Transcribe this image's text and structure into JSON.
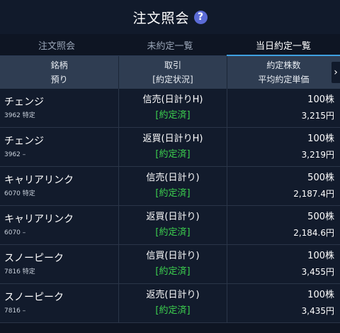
{
  "header": {
    "title": "注文照会",
    "help_icon": "?"
  },
  "tabs": [
    {
      "label": "注文照会",
      "active": false
    },
    {
      "label": "未約定一覧",
      "active": false
    },
    {
      "label": "当日約定一覧",
      "active": true
    }
  ],
  "columns": {
    "col1_top": "銘柄",
    "col1_bottom": "預り",
    "col2_top": "取引",
    "col2_bottom": "[約定状況]",
    "col3_top": "約定株数",
    "col3_bottom": "平均約定単価",
    "scroll_glyph": "›"
  },
  "rows": [
    {
      "name": "チェンジ",
      "code": "3962 特定",
      "type": "信売(日計りH)",
      "status": "[約定済]",
      "qty": "100株",
      "price": "3,215円"
    },
    {
      "name": "チェンジ",
      "code": "3962 –",
      "type": "返買(日計りH)",
      "status": "[約定済]",
      "qty": "100株",
      "price": "3,219円"
    },
    {
      "name": "キャリアリンク",
      "code": "6070 特定",
      "type": "信売(日計り)",
      "status": "[約定済]",
      "qty": "500株",
      "price": "2,187.4円"
    },
    {
      "name": "キャリアリンク",
      "code": "6070 –",
      "type": "返買(日計り)",
      "status": "[約定済]",
      "qty": "500株",
      "price": "2,184.6円"
    },
    {
      "name": "スノーピーク",
      "code": "7816 特定",
      "type": "信買(日計り)",
      "status": "[約定済]",
      "qty": "100株",
      "price": "3,455円"
    },
    {
      "name": "スノーピーク",
      "code": "7816 –",
      "type": "返売(日計り)",
      "status": "[約定済]",
      "qty": "100株",
      "price": "3,435円"
    }
  ],
  "colors": {
    "accent": "#3fa0e0",
    "status_green": "#3ccf4e",
    "help_bg": "#5b6bd6"
  }
}
